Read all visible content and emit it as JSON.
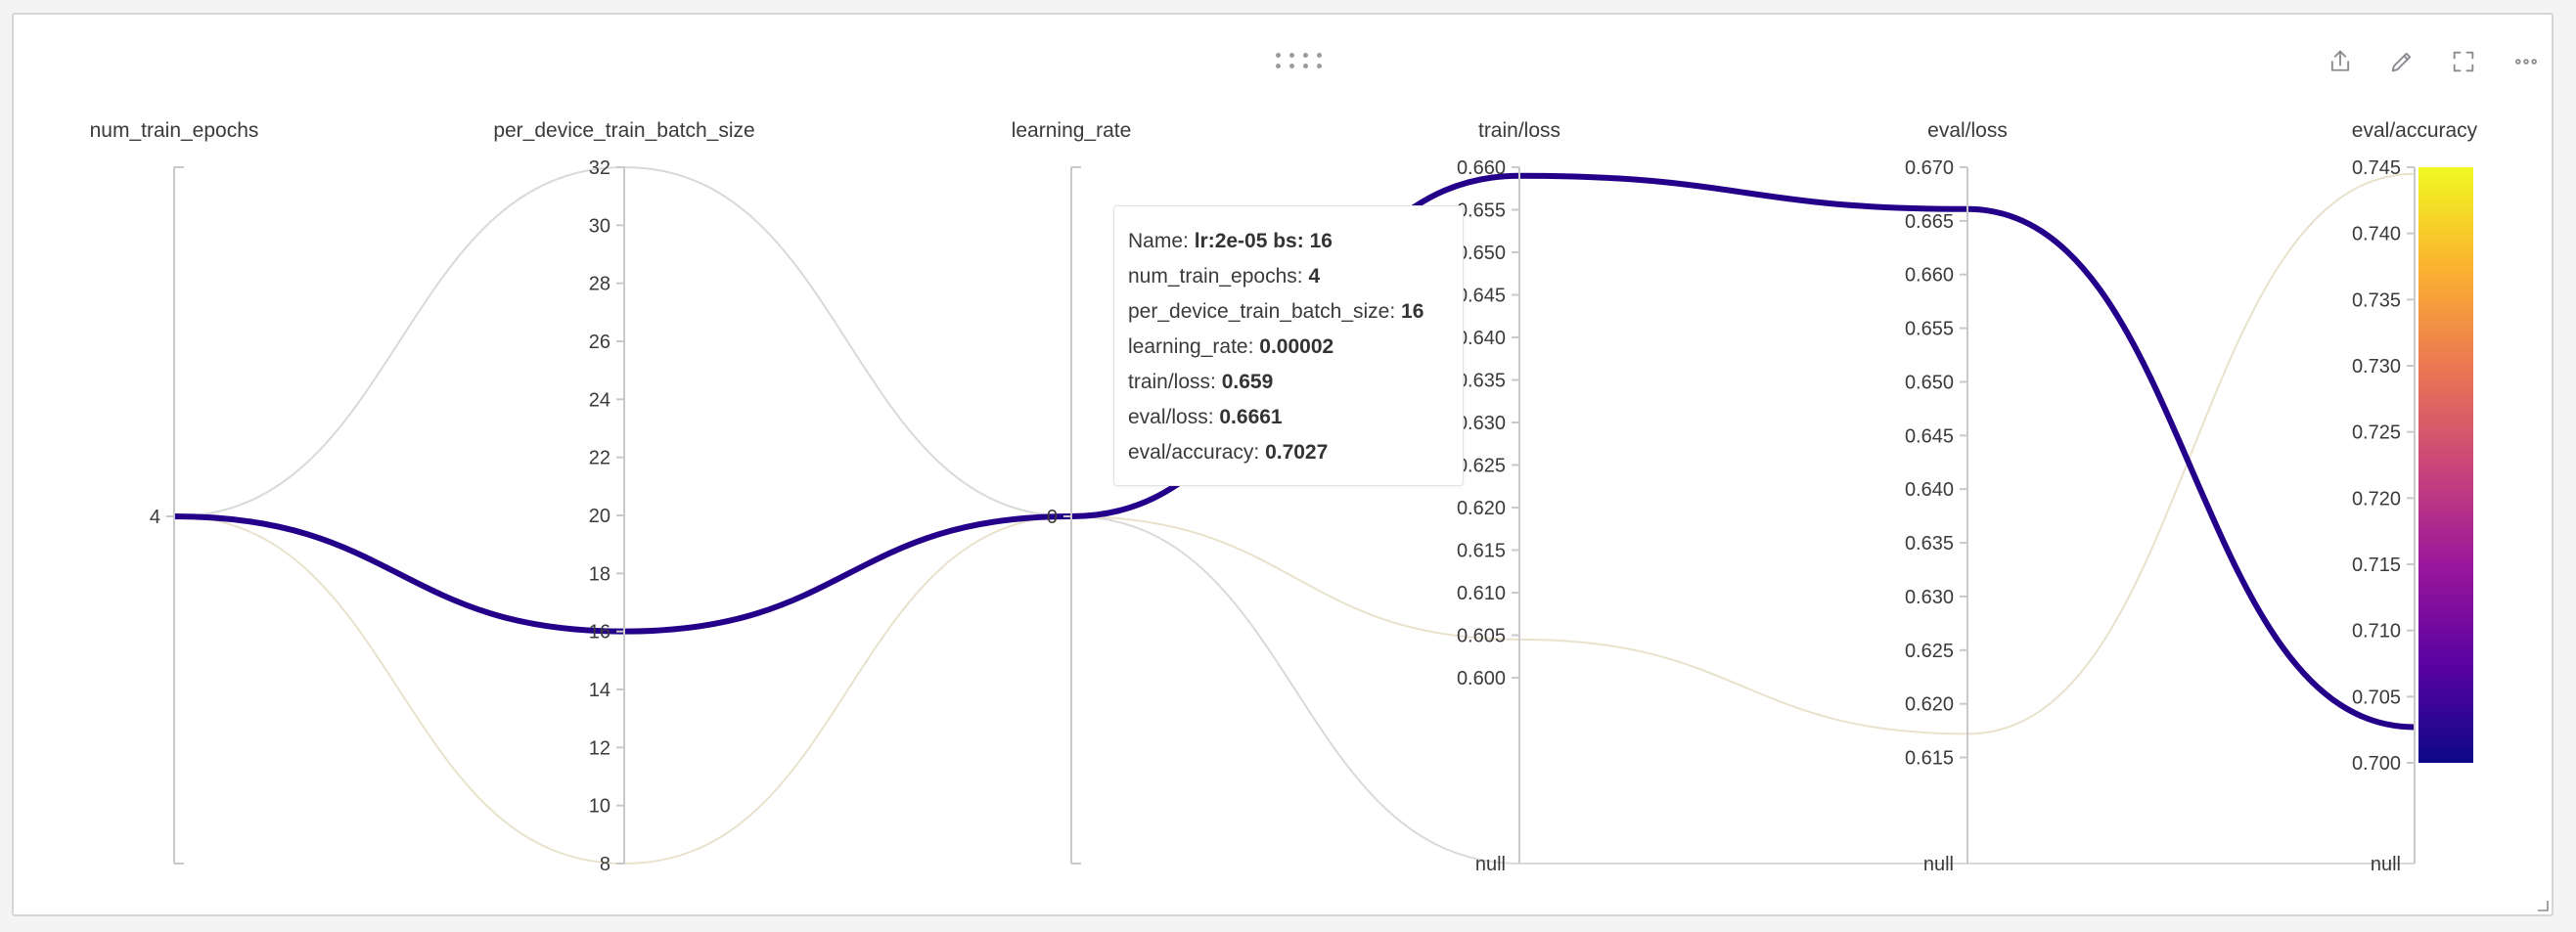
{
  "chart_data": {
    "type": "parallel_coordinates",
    "axes": [
      {
        "name": "num_train_epochs",
        "type": "linear",
        "ticks": [
          "4"
        ],
        "tick_values": [
          4
        ]
      },
      {
        "name": "per_device_train_batch_size",
        "type": "linear",
        "range": [
          8,
          32
        ],
        "ticks": [
          "8",
          "10",
          "12",
          "14",
          "16",
          "18",
          "20",
          "22",
          "24",
          "26",
          "28",
          "30",
          "32"
        ],
        "tick_values": [
          8,
          10,
          12,
          14,
          16,
          18,
          20,
          22,
          24,
          26,
          28,
          30,
          32
        ]
      },
      {
        "name": "learning_rate",
        "type": "linear",
        "ticks": [
          "0"
        ],
        "tick_values": [
          0
        ]
      },
      {
        "name": "train/loss",
        "type": "linear",
        "range": [
          0.59,
          0.66
        ],
        "has_null": true,
        "ticks": [
          "0.600",
          "0.605",
          "0.610",
          "0.615",
          "0.620",
          "0.625",
          "0.630",
          "0.635",
          "0.640",
          "0.645",
          "0.650",
          "0.655",
          "0.660"
        ],
        "tick_values": [
          0.6,
          0.605,
          0.61,
          0.615,
          0.62,
          0.625,
          0.63,
          0.635,
          0.64,
          0.645,
          0.65,
          0.655,
          0.66
        ]
      },
      {
        "name": "eval/loss",
        "type": "linear",
        "range": [
          0.6145,
          0.67
        ],
        "has_null": true,
        "ticks": [
          "0.615",
          "0.620",
          "0.625",
          "0.630",
          "0.635",
          "0.640",
          "0.645",
          "0.650",
          "0.655",
          "0.660",
          "0.665",
          "0.670"
        ],
        "tick_values": [
          0.615,
          0.62,
          0.625,
          0.63,
          0.635,
          0.64,
          0.645,
          0.65,
          0.655,
          0.66,
          0.665,
          0.67
        ]
      },
      {
        "name": "eval/accuracy",
        "type": "linear",
        "range": [
          0.7,
          0.745
        ],
        "has_null": true,
        "ticks": [
          "0.700",
          "0.705",
          "0.710",
          "0.715",
          "0.720",
          "0.725",
          "0.730",
          "0.735",
          "0.740",
          "0.745"
        ],
        "tick_values": [
          0.7,
          0.705,
          0.71,
          0.715,
          0.72,
          0.725,
          0.73,
          0.735,
          0.74,
          0.745
        ]
      }
    ],
    "null_label": "null",
    "runs": [
      {
        "name": "lr:2e-05 bs: 16",
        "highlighted": true,
        "color": "#24008a",
        "values": [
          4,
          16,
          0,
          0.659,
          0.6661,
          0.7027
        ]
      },
      {
        "name": "",
        "highlighted": false,
        "color": "#d9d9dc",
        "values": [
          4,
          32,
          0,
          null,
          null,
          null
        ]
      },
      {
        "name": "",
        "highlighted": false,
        "color": "#e8e2cc",
        "values": [
          4,
          8,
          0,
          0.6045,
          0.6172,
          0.7445
        ]
      }
    ],
    "colorbar": {
      "axis": "eval/accuracy",
      "range": [
        0.7,
        0.745
      ],
      "colors": [
        "#0d0887",
        "#5b02a3",
        "#9a179b",
        "#cb4678",
        "#eb7852",
        "#fbb32f",
        "#f0f921"
      ]
    },
    "grid": false
  },
  "tooltip": {
    "rows": [
      {
        "label": "Name: ",
        "value": "lr:2e-05 bs: 16"
      },
      {
        "label": "num_train_epochs: ",
        "value": "4"
      },
      {
        "label": "per_device_train_batch_size: ",
        "value": "16"
      },
      {
        "label": "learning_rate: ",
        "value": "0.00002"
      },
      {
        "label": "train/loss: ",
        "value": "0.659"
      },
      {
        "label": "eval/loss: ",
        "value": "0.6661"
      },
      {
        "label": "eval/accuracy: ",
        "value": "0.7027"
      }
    ]
  },
  "toolbar": {
    "icons": [
      "share-icon",
      "edit-icon",
      "fullscreen-icon",
      "more-icon"
    ]
  }
}
